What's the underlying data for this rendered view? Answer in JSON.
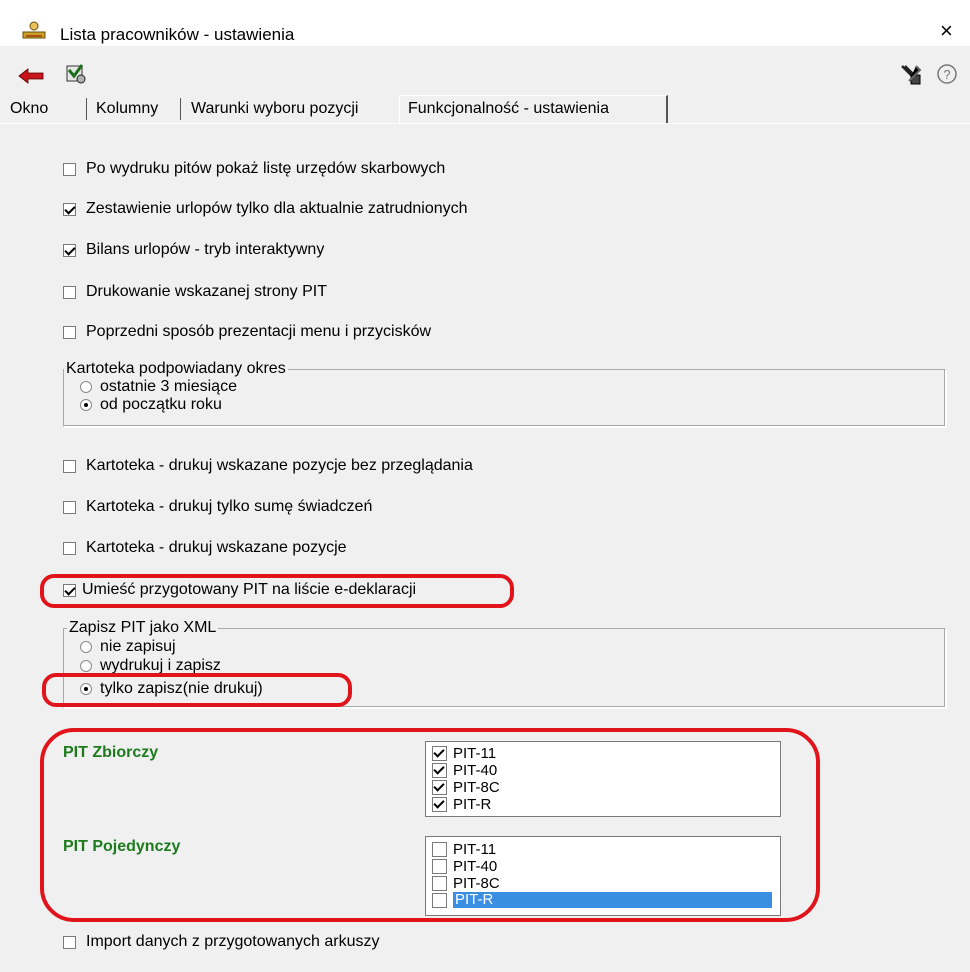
{
  "window": {
    "title": "Lista pracowników - ustawienia",
    "close_label": "×",
    "help_label": "?"
  },
  "toolbar": {
    "back_icon": "back-arrow-icon",
    "settings_icon": "settings-tool-icon",
    "tools_icon": "wrench-icon",
    "help_icon": "help-circle-icon"
  },
  "tabs": [
    {
      "label": "Okno"
    },
    {
      "label": "Kolumny"
    },
    {
      "label": "Warunki wyboru pozycji"
    },
    {
      "label": "Funkcjonalność - ustawienia",
      "active": true
    }
  ],
  "options_top": [
    {
      "label": "Po wydruku pitów pokaż listę urzędów skarbowych",
      "checked": false
    },
    {
      "label": "Zestawienie urlopów tylko dla aktualnie zatrudnionych",
      "checked": true
    },
    {
      "label": "Bilans urlopów - tryb interaktywny",
      "checked": true
    },
    {
      "label": "Drukowanie wskazanej strony PIT",
      "checked": false
    },
    {
      "label": "Poprzedni sposób prezentacji menu i przycisków",
      "checked": false
    }
  ],
  "kartoteka_group": {
    "title": "Kartoteka podpowiadany okres",
    "options": [
      {
        "label": "ostatnie 3 miesiące",
        "selected": false
      },
      {
        "label": "od początku roku",
        "selected": true
      }
    ]
  },
  "options_mid": [
    {
      "label": "Kartoteka - drukuj wskazane pozycje bez przeglądania",
      "checked": false
    },
    {
      "label": "Kartoteka - drukuj tylko sumę świadczeń",
      "checked": false
    },
    {
      "label": "Kartoteka - drukuj wskazane pozycje",
      "checked": false
    },
    {
      "label": "Umieść przygotowany PIT na liście e-deklaracji",
      "checked": true
    }
  ],
  "xml_group": {
    "title": "Zapisz PIT jako XML",
    "options": [
      {
        "label": "nie zapisuj",
        "selected": false
      },
      {
        "label": "wydrukuj i zapisz",
        "selected": false
      },
      {
        "label": "tylko zapisz(nie drukuj)",
        "selected": true
      }
    ]
  },
  "pit_zbiorczy": {
    "label": "PIT Zbiorczy",
    "items": [
      {
        "label": "PIT-11",
        "checked": true
      },
      {
        "label": "PIT-40",
        "checked": true
      },
      {
        "label": "PIT-8C",
        "checked": true
      },
      {
        "label": "PIT-R",
        "checked": true
      }
    ]
  },
  "pit_pojedynczy": {
    "label": "PIT Pojedynczy",
    "items": [
      {
        "label": "PIT-11",
        "checked": false
      },
      {
        "label": "PIT-40",
        "checked": false
      },
      {
        "label": "PIT-8C",
        "checked": false
      },
      {
        "label": "PIT-R",
        "checked": false,
        "highlighted": true
      }
    ]
  },
  "bottom_option": {
    "label": "Import danych z przygotowanych arkuszy",
    "checked": false
  },
  "colors": {
    "highlight_oval": "#e0141a",
    "pit_label": "#1d7a1d",
    "selection": "#3a8fe3"
  }
}
